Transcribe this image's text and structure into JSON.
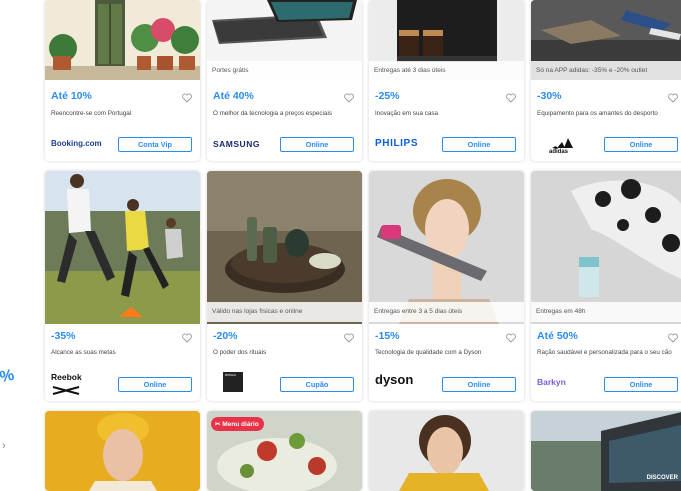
{
  "rows": [
    [
      {
        "strip": "",
        "discount": "Até 10%",
        "desc": "Reencontre-se com Portugal",
        "logo": "Booking.com",
        "button": "Conta Vip"
      },
      {
        "strip": "Portes grátis",
        "discount": "Até 40%",
        "desc": "O melhor da tecnologia a preços especiais",
        "logo": "SAMSUNG",
        "button": "Online"
      },
      {
        "strip": "Entregas até 3 dias úteis",
        "discount": "-25%",
        "desc": "Inovação em sua casa",
        "logo": "PHILIPS",
        "button": "Online"
      },
      {
        "strip": "Só na APP adidas: -35% e -20% outlet",
        "discount": "-30%",
        "desc": "Equipamento para os amantes do desporto",
        "logo": "adidas",
        "button": "Online"
      }
    ],
    [
      {
        "strip": "",
        "discount": "-35%",
        "desc": "Alcance as suas metas",
        "logo": "Reebok",
        "button": "Online"
      },
      {
        "strip": "Válido nas lojas físicas e online",
        "discount": "-20%",
        "desc": "O poder dos rituais",
        "logo": "RITUALS",
        "button": "Cupão"
      },
      {
        "strip": "Entregas entre 3 a 5 dias úteis",
        "discount": "-15%",
        "desc": "Tecnologia de qualidade com a Dyson",
        "logo": "dyson",
        "button": "Online"
      },
      {
        "strip": "Entregas em 48h",
        "discount": "Até 50%",
        "desc": "Ração saudável e personalizada para o seu cão",
        "logo": "Barkyn",
        "button": "Online"
      }
    ]
  ],
  "row3": {
    "menu_badge": "Menu diário",
    "discover": "DISCOVER"
  },
  "rail": {
    "percent": "%"
  },
  "colors": {
    "accent": "#2a8cf0",
    "badge": "#e73349"
  }
}
